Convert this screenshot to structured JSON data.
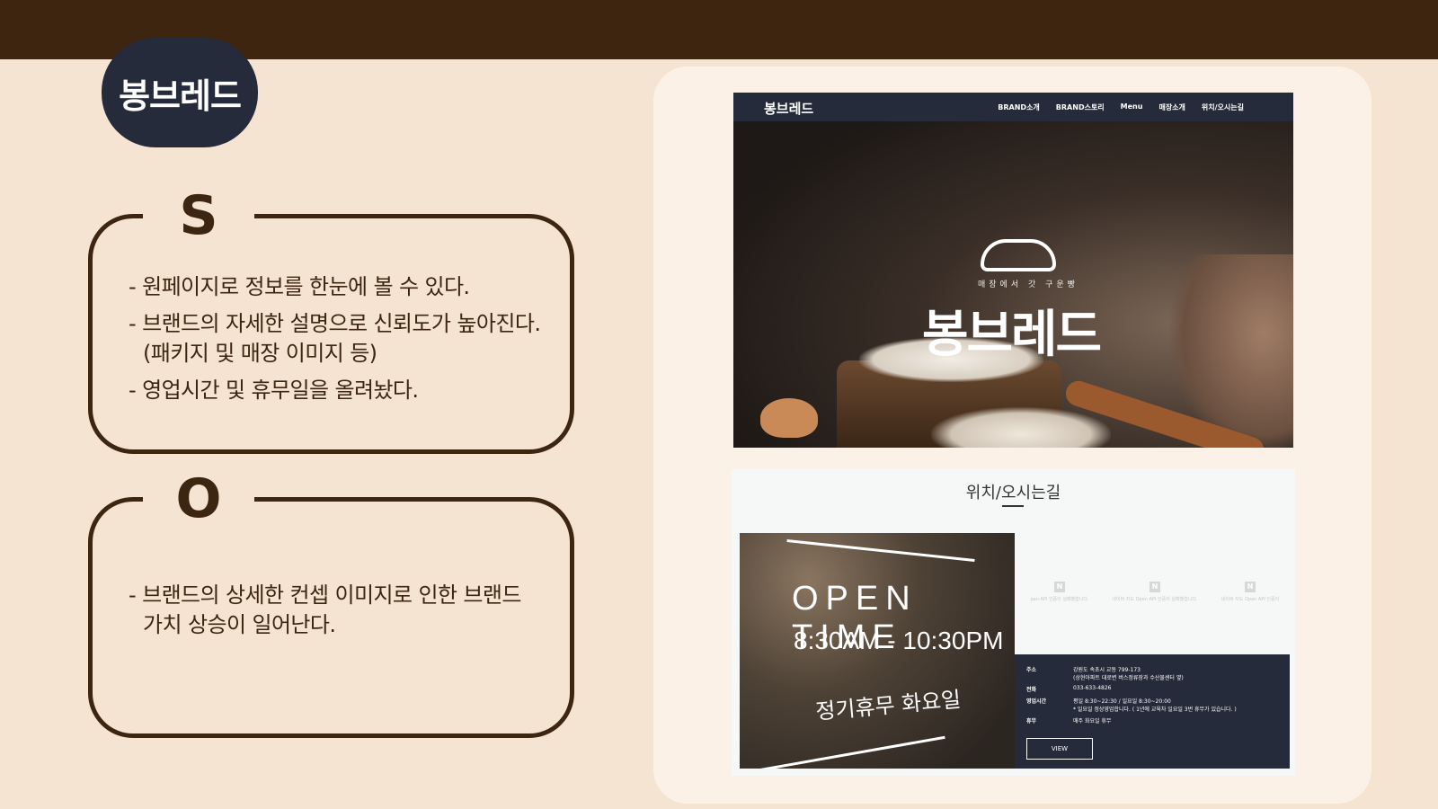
{
  "colors": {
    "page_bg": "#f5e4d1",
    "top_bar": "#3e2510",
    "accent_brown": "#3d2611",
    "navy": "#262b3b",
    "panel_bg": "#fbf1e6"
  },
  "brand": {
    "logo_text": "봉브레드"
  },
  "strength": {
    "letter": "S",
    "items": [
      "- 원페이지로 정보를 한눈에 볼 수 있다.",
      "- 브랜드의 자세한 설명으로 신뢰도가 높아진다.\n(패키지 및 매장 이미지 등)",
      "- 영업시간 및 휴무일을 올려놨다."
    ]
  },
  "opportunity": {
    "letter": "O",
    "items": [
      "- 브랜드의 상세한 컨셉 이미지로 인한 브랜드\n가치 상승이 일어난다."
    ]
  },
  "mockup": {
    "hero": {
      "logo": "봉브레드",
      "menu": [
        "BRAND소개",
        "BRAND스토리",
        "Menu",
        "매장소개",
        "위치/오시는길"
      ],
      "tagline": "매장에서 갓 구운빵",
      "brand": "봉브레드"
    },
    "location": {
      "title": "위치/오시는길",
      "photo": {
        "open_text": "OPEN TIME",
        "hours": "8:30AM - 10:30PM",
        "closed": "정기휴무 화요일"
      },
      "map_messages": [
        "pen API 인증이 실패했습니다.",
        "네이버 지도 Open API 인증이 실패했습니다.",
        "네이버 지도 Open API 인증이"
      ],
      "info": {
        "rows": [
          {
            "label": "주소",
            "value": "강원도 속초시 교동 799-173\n(상현아파트 대로변 버스정류장과 수산물센터 옆)"
          },
          {
            "label": "전화",
            "value": "033-633-4826"
          },
          {
            "label": "영업시간",
            "value": "평일 8:30~22:30 / 일요일 8:30~20:00\n* 일요일 정상영업합니다. ( 1년에 교육차 일요일 3번 휴무가 있습니다. )"
          },
          {
            "label": "휴무",
            "value": "매주 화요일 휴무"
          }
        ],
        "view_button": "VIEW"
      }
    }
  }
}
